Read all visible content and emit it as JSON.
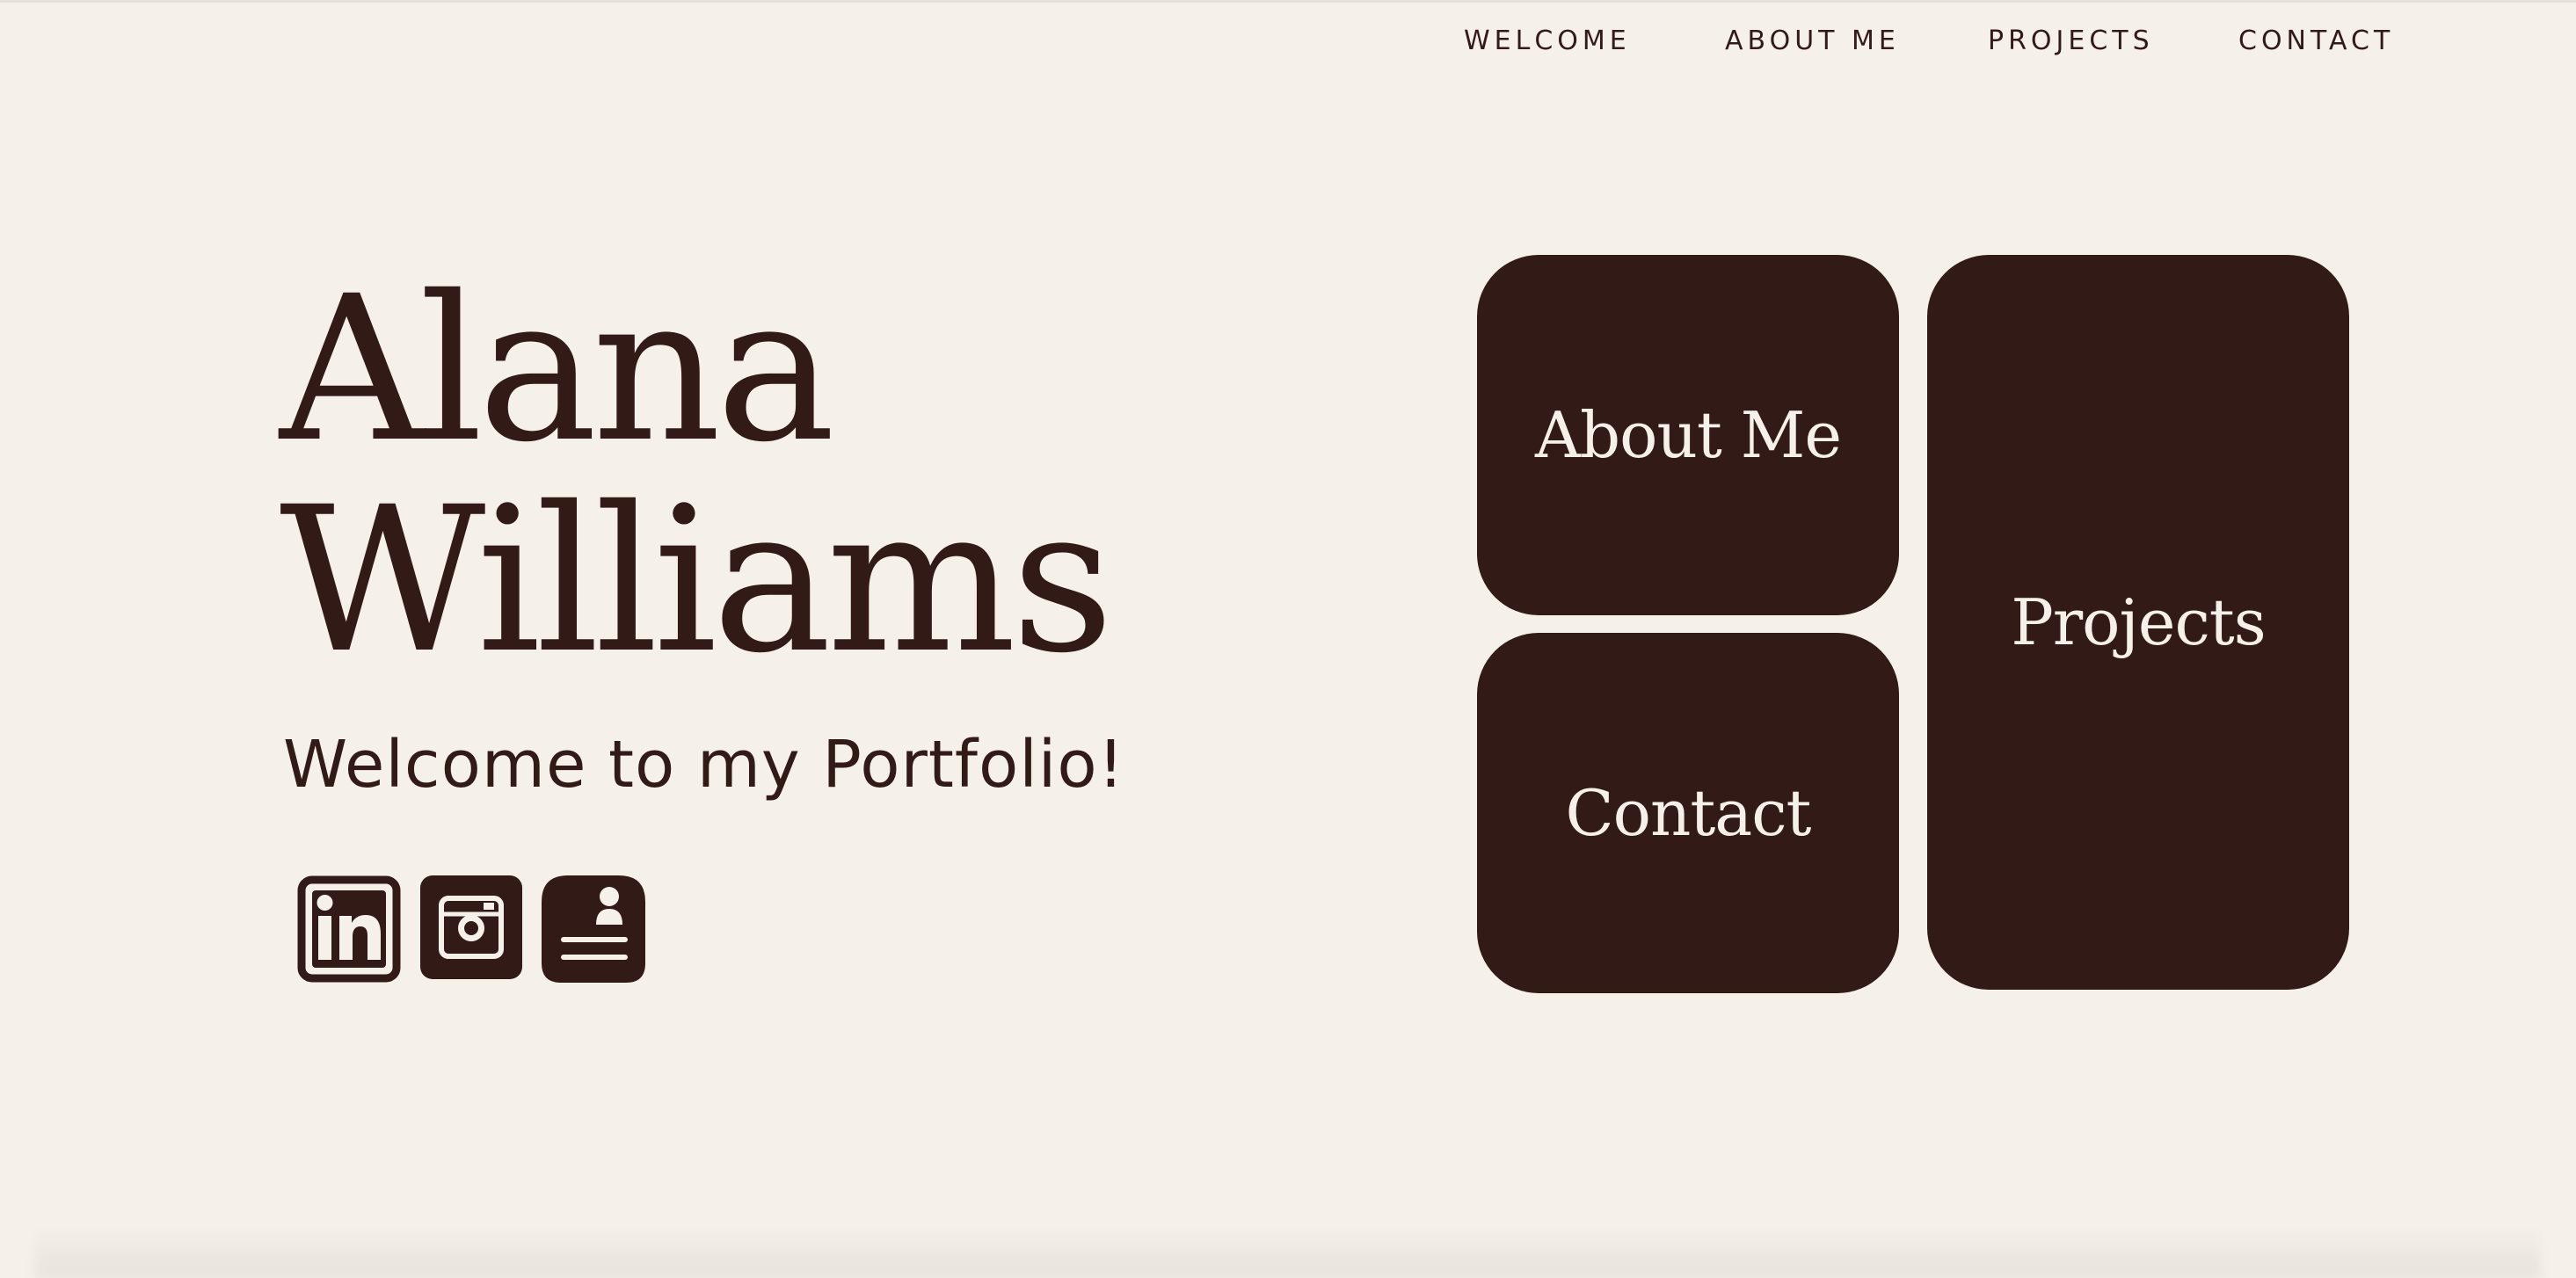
{
  "nav": {
    "items": [
      {
        "label": "WELCOME"
      },
      {
        "label": "ABOUT ME"
      },
      {
        "label": "PROJECTS"
      },
      {
        "label": "CONTACT"
      }
    ]
  },
  "hero": {
    "name_line1": "Alana",
    "name_line2": "Williams",
    "subtitle": "Welcome to my Portfolio!"
  },
  "social": {
    "icons": [
      "linkedin-icon",
      "instagram-icon",
      "contact-card-icon"
    ]
  },
  "tiles": {
    "about_label": "About Me",
    "contact_label": "Contact",
    "projects_label": "Projects"
  },
  "colors": {
    "background": "#f6f1e8",
    "accent": "#321b17",
    "tile_text": "#f6f1e8"
  }
}
